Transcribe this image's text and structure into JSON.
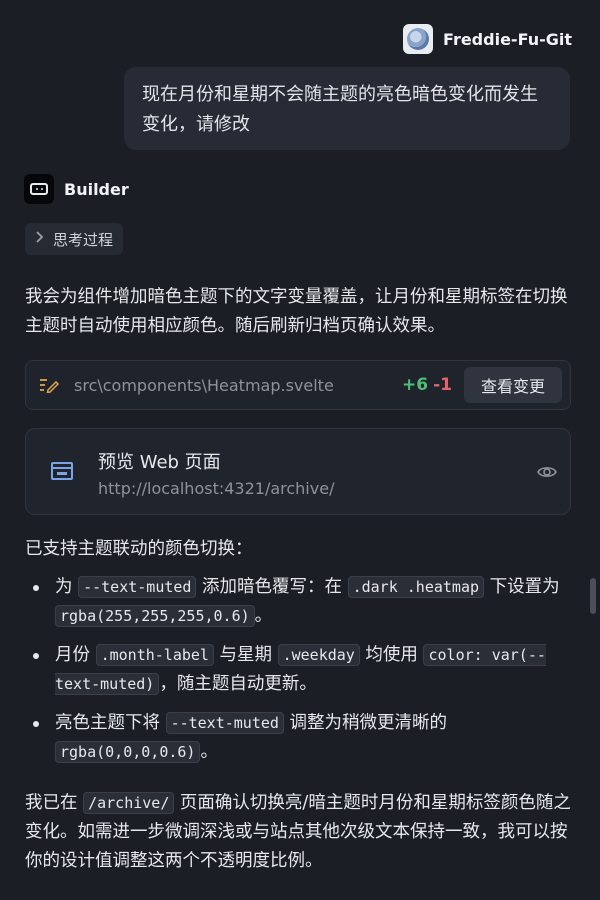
{
  "user": {
    "name": "Freddie-Fu-Git",
    "message": "现在月份和星期不会随主题的亮色暗色变化而发生变化，请修改"
  },
  "builder": {
    "name": "Builder",
    "think_label": "思考过程",
    "intro": "我会为组件增加暗色主题下的文字变量覆盖，让月份和星期标签在切换主题时自动使用相应颜色。随后刷新归档页确认效果。"
  },
  "file_change": {
    "path": "src\\components\\Heatmap.svelte",
    "added": "+6",
    "removed": "-1",
    "view_label": "查看变更"
  },
  "preview": {
    "title": "预览 Web 页面",
    "url": "http://localhost:4321/archive/"
  },
  "summary_heading": "已支持主题联动的颜色切换：",
  "bullets": [
    {
      "t1": "为 ",
      "c1": "--text-muted",
      "t2": " 添加暗色覆写：在 ",
      "c2": ".dark .heatmap",
      "t3": " 下设置为 ",
      "c3": "rgba(255,255,255,0.6)",
      "t4": "。"
    },
    {
      "t1": "月份 ",
      "c1": ".month-label",
      "t2": " 与星期 ",
      "c2": ".weekday",
      "t3": " 均使用 ",
      "c3": "color: var(--text-muted)",
      "t4": "，随主题自动更新。"
    },
    {
      "t1": "亮色主题下将 ",
      "c1": "--text-muted",
      "t2": " 调整为稍微更清晰的 ",
      "c2": "rgba(0,0,0,0.6)",
      "t3": "。"
    }
  ],
  "closing": {
    "t1": "我已在 ",
    "c1": "/archive/",
    "t2": " 页面确认切换亮/暗主题时月份和星期标签颜色随之变化。如需进一步微调深浅或与站点其他次级文本保持一致，我可以按你的设计值调整这两个不透明度比例。"
  },
  "colors": {
    "background": "#1b1e25",
    "added": "#4fbf78",
    "removed": "#e8636a",
    "accent": "#7ba4e6",
    "edit_icon": "#e0a64b"
  },
  "icons": {
    "avatar": "user-avatar",
    "builder": "builder-icon",
    "chevron": "chevron-right-icon",
    "edit": "edit-file-icon",
    "window": "browser-window-icon",
    "eye": "eye-icon"
  }
}
